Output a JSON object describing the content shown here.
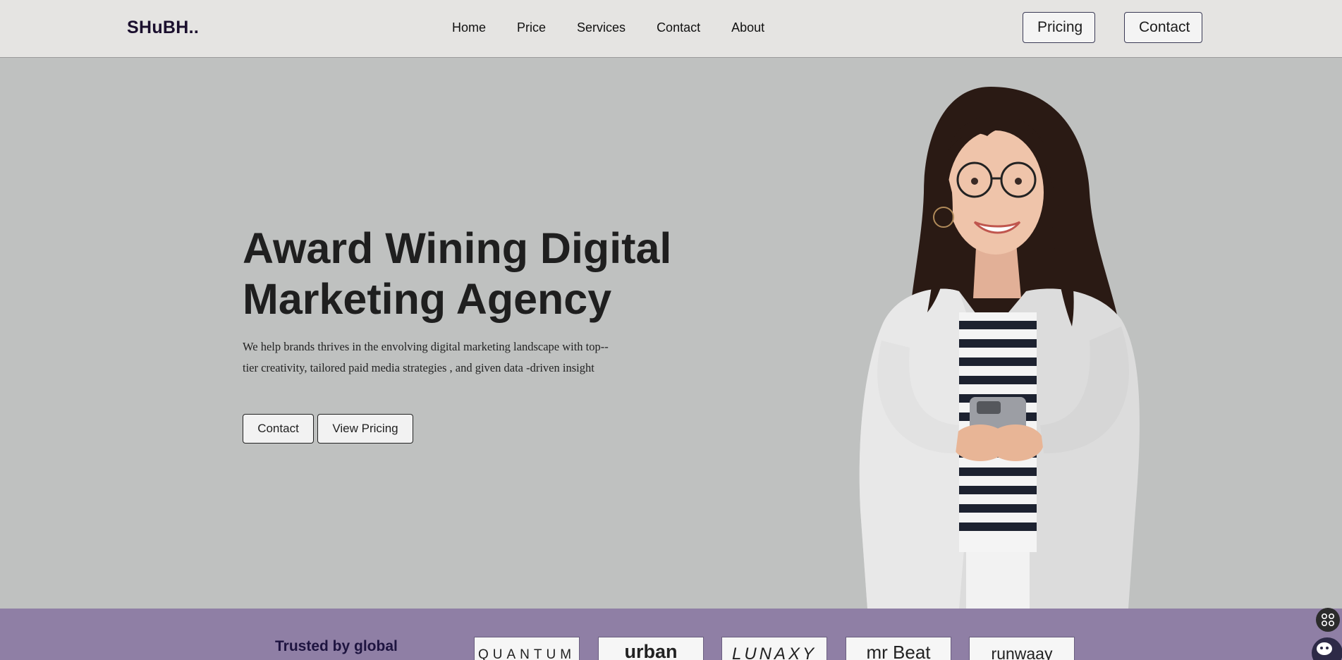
{
  "nav": {
    "logo": "SHuBH..",
    "menu": [
      "Home",
      "Price",
      "Services",
      "Contact",
      "About"
    ],
    "pricing_button": "Pricing",
    "contact_button": "Contact"
  },
  "hero": {
    "title": "Award Wining Digital Marketing Agency",
    "description": "We help brands thrives in the envolving digital marketing landscape with top--tier creativity, tailored paid media strategies , and given data -driven insight",
    "contact_button": "Contact",
    "pricing_button": "View Pricing"
  },
  "trusted": {
    "heading": "Trusted by global",
    "logos": [
      "QUANTUM",
      "urban",
      "LUNAXY",
      "mr Beat",
      "runwaay"
    ]
  },
  "colors": {
    "nav_bg": "#e5e4e2",
    "hero_bg": "#bfc1c0",
    "band_bg": "#8f7fa5",
    "logo_text": "#1b0f2e"
  }
}
